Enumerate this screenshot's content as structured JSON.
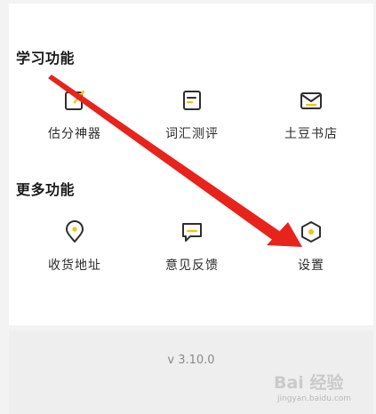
{
  "sections": [
    {
      "title": "学习功能",
      "items": [
        {
          "label": "估分神器",
          "icon": "edit-note-icon"
        },
        {
          "label": "词汇测评",
          "icon": "document-icon"
        },
        {
          "label": "土豆书店",
          "icon": "mail-icon"
        }
      ]
    },
    {
      "title": "更多功能",
      "items": [
        {
          "label": "收货地址",
          "icon": "location-pin-icon"
        },
        {
          "label": "意见反馈",
          "icon": "feedback-icon"
        },
        {
          "label": "设置",
          "icon": "settings-hexagon-icon"
        }
      ]
    }
  ],
  "footer": {
    "version": "v 3.10.0"
  },
  "watermark": {
    "text": "Bai 经验",
    "url": "jingyan.baidu.com"
  },
  "colors": {
    "accent": "#f5c400",
    "icon_stroke": "#2e2e2e",
    "annotation_arrow": "#e8231c"
  }
}
